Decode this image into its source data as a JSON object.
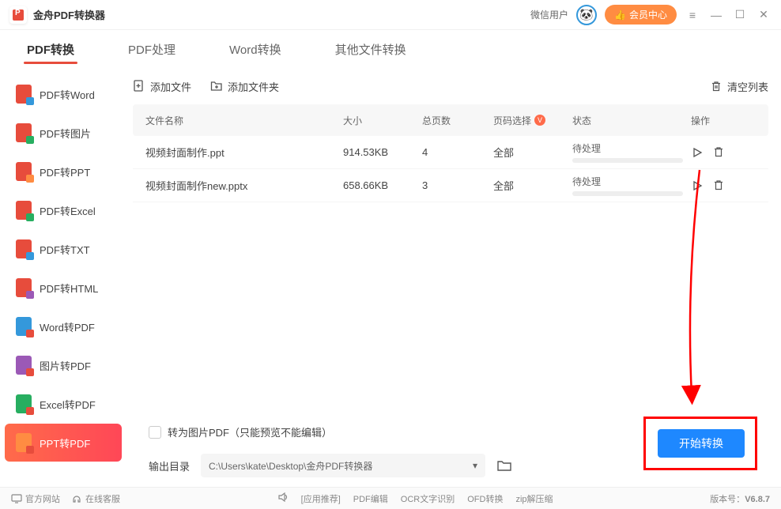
{
  "app": {
    "title": "金舟PDF转换器"
  },
  "titlebar": {
    "wechat_user": "微信用户",
    "member_center": "会员中心"
  },
  "tabs": [
    {
      "label": "PDF转换",
      "active": true
    },
    {
      "label": "PDF处理",
      "active": false
    },
    {
      "label": "Word转换",
      "active": false
    },
    {
      "label": "其他文件转换",
      "active": false
    }
  ],
  "sidebar": [
    {
      "label": "PDF转Word",
      "icon": "fi-red fi-sub-blue"
    },
    {
      "label": "PDF转图片",
      "icon": "fi-red fi-sub-green"
    },
    {
      "label": "PDF转PPT",
      "icon": "fi-red fi-sub-orange"
    },
    {
      "label": "PDF转Excel",
      "icon": "fi-red fi-sub-green"
    },
    {
      "label": "PDF转TXT",
      "icon": "fi-red fi-sub-blue"
    },
    {
      "label": "PDF转HTML",
      "icon": "fi-red fi-sub-purple"
    },
    {
      "label": "Word转PDF",
      "icon": "fi-blue fi-sub-red"
    },
    {
      "label": "图片转PDF",
      "icon": "fi-purple fi-sub-red"
    },
    {
      "label": "Excel转PDF",
      "icon": "fi-green fi-sub-red"
    },
    {
      "label": "PPT转PDF",
      "icon": "fi-orange fi-sub-red",
      "active": true
    }
  ],
  "toolbar": {
    "add_file": "添加文件",
    "add_folder": "添加文件夹",
    "clear_list": "清空列表"
  },
  "table": {
    "headers": {
      "name": "文件名称",
      "size": "大小",
      "pages": "总页数",
      "select": "页码选择",
      "status": "状态",
      "ops": "操作"
    },
    "rows": [
      {
        "name": "视频封面制作.ppt",
        "size": "914.53KB",
        "pages": "4",
        "select": "全部",
        "status": "待处理"
      },
      {
        "name": "视频封面制作new.pptx",
        "size": "658.66KB",
        "pages": "3",
        "select": "全部",
        "status": "待处理"
      }
    ]
  },
  "bottom": {
    "checkbox_label": "转为图片PDF（只能预览不能编辑）",
    "output_label": "输出目录",
    "output_path": "C:\\Users\\kate\\Desktop\\金舟PDF转换器",
    "start_button": "开始转换"
  },
  "footer": {
    "official_site": "官方网站",
    "online_service": "在线客服",
    "links": [
      "[应用推荐]",
      "PDF编辑",
      "OCR文字识别",
      "OFD转换",
      "zip解压缩"
    ],
    "version_label": "版本号：",
    "version": "V6.8.7"
  }
}
